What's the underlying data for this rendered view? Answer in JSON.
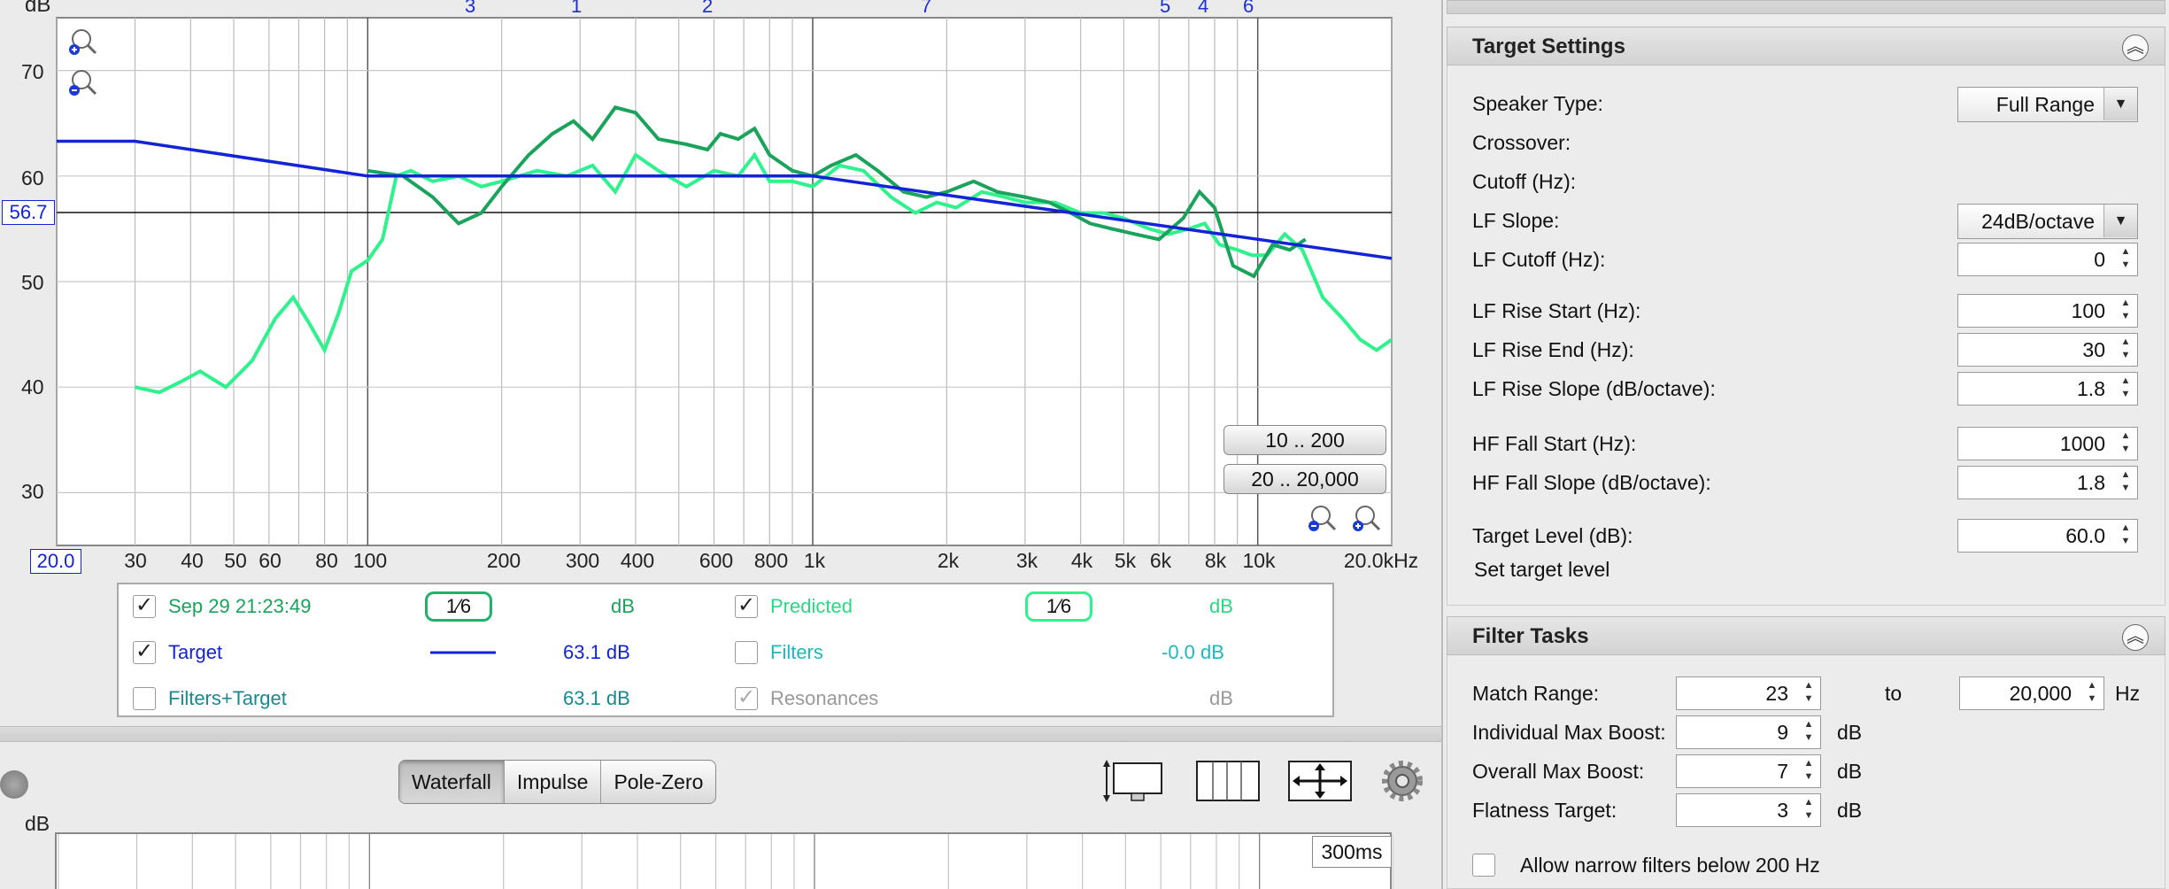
{
  "plot": {
    "y_unit": "dB",
    "y_ticks": [
      "70",
      "60",
      "50",
      "40",
      "30"
    ],
    "x_ticks": [
      "30",
      "40",
      "50",
      "60",
      "80",
      "100",
      "200",
      "300",
      "400",
      "600",
      "800",
      "1k",
      "2k",
      "3k",
      "4k",
      "5k",
      "6k",
      "8k",
      "10k",
      "20.0kHz"
    ],
    "x_start": "20.0",
    "cursor_level": "56.7",
    "resonance_markers": [
      "3",
      "1",
      "2",
      "7",
      "5",
      "4",
      "6"
    ],
    "range_buttons": [
      "10 .. 200",
      "20 .. 20,000"
    ],
    "colors": {
      "measurement": "#1aa35a",
      "predicted": "#2ef28c",
      "target": "#1323d6"
    }
  },
  "legend": {
    "rows": [
      {
        "name": "Sep 29 21:23:49",
        "checked": "✓",
        "smoothing": "1⁄6",
        "value": "dB",
        "color": "#1aa35a"
      },
      {
        "name": "Target",
        "checked": "✓",
        "value": "63.1 dB",
        "color": "#1323d6"
      },
      {
        "name": "Filters+Target",
        "checked": "",
        "value": "63.1 dB",
        "color": "#168a90"
      },
      {
        "name": "Predicted",
        "checked": "✓",
        "smoothing": "1⁄6",
        "value": "dB",
        "color": "#2ad883"
      },
      {
        "name": "Filters",
        "checked": "",
        "value": "-0.0 dB",
        "color": "#1fb8b8"
      },
      {
        "name": "Resonances",
        "checked": "✓",
        "value": "dB",
        "color": "#999999"
      }
    ]
  },
  "view_tabs": [
    "Waterfall",
    "Impulse",
    "Pole-Zero"
  ],
  "lower_plot": {
    "y_unit": "dB",
    "time_window": "300ms"
  },
  "target_settings": {
    "title": "Target Settings",
    "speaker_type_label": "Speaker Type:",
    "speaker_type_value": "Full Range",
    "crossover_label": "Crossover:",
    "cutoff_label": "Cutoff (Hz):",
    "lf_slope_label": "LF Slope:",
    "lf_slope_value": "24dB/octave",
    "lf_cutoff_label": "LF Cutoff (Hz):",
    "lf_cutoff_value": "0",
    "lf_rise_start_label": "LF Rise Start (Hz):",
    "lf_rise_start_value": "100",
    "lf_rise_end_label": "LF Rise End (Hz):",
    "lf_rise_end_value": "30",
    "lf_rise_slope_label": "LF Rise Slope (dB/octave):",
    "lf_rise_slope_value": "1.8",
    "hf_fall_start_label": "HF Fall Start (Hz):",
    "hf_fall_start_value": "1000",
    "hf_fall_slope_label": "HF Fall Slope (dB/octave):",
    "hf_fall_slope_value": "1.8",
    "target_level_label": "Target Level (dB):",
    "target_level_value": "60.0",
    "set_target_level": "Set target level"
  },
  "filter_tasks": {
    "title": "Filter Tasks",
    "match_range_label": "Match Range:",
    "match_range_from": "23",
    "to_label": "to",
    "match_range_to": "20,000",
    "hz_unit": "Hz",
    "individual_max_boost_label": "Individual Max Boost:",
    "individual_max_boost_value": "9",
    "overall_max_boost_label": "Overall Max Boost:",
    "overall_max_boost_value": "7",
    "flatness_target_label": "Flatness Target:",
    "flatness_target_value": "3",
    "db_unit": "dB",
    "allow_narrow_label": "Allow narrow filters below 200 Hz"
  }
}
